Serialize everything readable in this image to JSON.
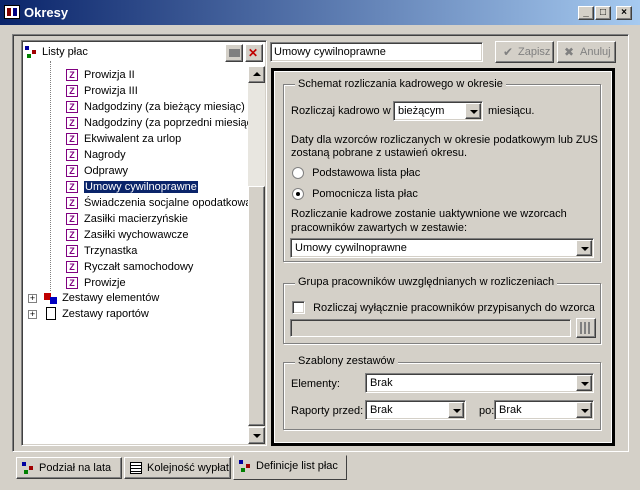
{
  "window": {
    "title": "Okresy",
    "minimize": "_",
    "maximize": "□",
    "close": "×"
  },
  "tree": {
    "root_label": "Listy płac",
    "items": [
      {
        "label": "Prowizja II",
        "selected": false
      },
      {
        "label": "Prowizja III",
        "selected": false
      },
      {
        "label": "Nadgodziny (za bieżący miesiąc)",
        "selected": false
      },
      {
        "label": "Nadgodziny (za poprzedni miesiąc)",
        "selected": false
      },
      {
        "label": "Ekwiwalent za urlop",
        "selected": false
      },
      {
        "label": "Nagrody",
        "selected": false
      },
      {
        "label": "Odprawy",
        "selected": false
      },
      {
        "label": "Umowy cywilnoprawne",
        "selected": true
      },
      {
        "label": "Świadczenia socjalne opodatkowa",
        "selected": false
      },
      {
        "label": "Zasiłki macierzyńskie",
        "selected": false
      },
      {
        "label": "Zasiłki wychowawcze",
        "selected": false
      },
      {
        "label": "Trzynastka",
        "selected": false
      },
      {
        "label": "Ryczałt samochodowy",
        "selected": false
      },
      {
        "label": "Prowizje",
        "selected": false
      }
    ],
    "groups": [
      {
        "label": "Zestawy elementów"
      },
      {
        "label": "Zestawy raportów"
      }
    ]
  },
  "header": {
    "name_value": "Umowy cywilnoprawne",
    "save_label": "Zapisz",
    "cancel_label": "Anuluj"
  },
  "schema": {
    "legend": "Schemat rozliczania kadrowego w okresie",
    "rozliczaj_label": "Rozliczaj kadrowo w",
    "rozliczaj_value": "bieżącym",
    "miesiac_label": "miesiącu.",
    "info_text_1": "Daty dla wzorców rozliczanych w okresie podatkowym lub ZUS",
    "info_text_2": "zostaną pobrane z ustawień okresu.",
    "radio_basic": "Podstawowa lista płac",
    "radio_aux": "Pomocnicza lista płac",
    "radio_selected": "aux",
    "activation_text_1": "Rozliczanie kadrowe zostanie uaktywnione we wzorcach",
    "activation_text_2": "pracowników zawartych w zestawie:",
    "zestaw_value": "Umowy cywilnoprawne"
  },
  "group": {
    "legend": "Grupa pracowników uwzględnianych w rozliczeniach",
    "checkbox_label": "Rozliczaj wyłącznie pracowników przypisanych do wzorca",
    "checked": false
  },
  "templates": {
    "legend": "Szablony zestawów",
    "elements_label": "Elementy:",
    "elements_value": "Brak",
    "reports_label": "Raporty przed:",
    "reports_value": "Brak",
    "po_label": "po:",
    "po_value": "Brak"
  },
  "tabs": [
    {
      "label": "Podział na lata",
      "active": false
    },
    {
      "label": "Kolejność wypłat",
      "active": false
    },
    {
      "label": "Definicje list płac",
      "active": true
    }
  ],
  "colors": {
    "selection": "#0a246a",
    "titlebar": "#0a246a",
    "face": "#d4d0c8"
  }
}
